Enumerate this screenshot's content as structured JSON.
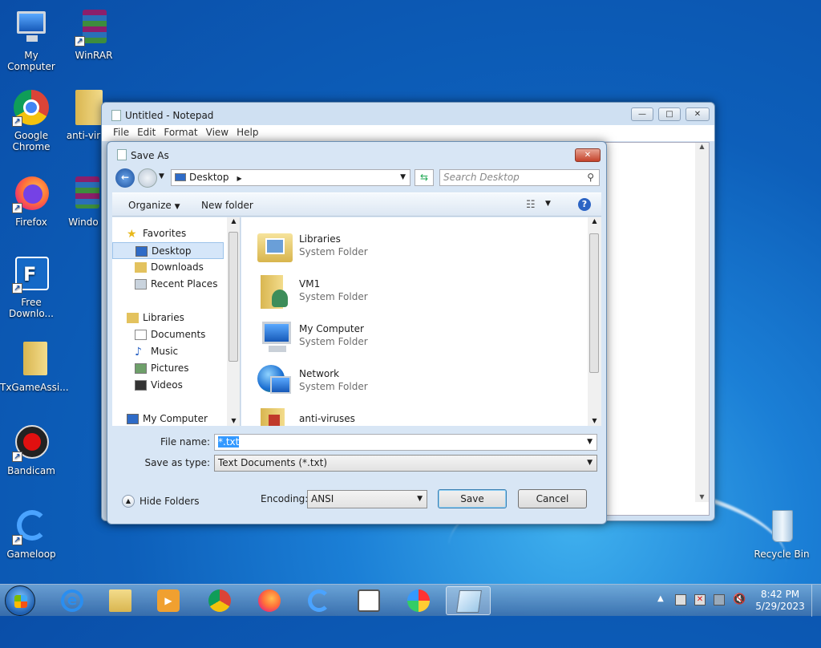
{
  "desktop": {
    "icons": [
      {
        "label": "My Computer"
      },
      {
        "label": "WinRAR"
      },
      {
        "label": "Google Chrome"
      },
      {
        "label": "anti-vir"
      },
      {
        "label": "Firefox"
      },
      {
        "label": "Windo"
      },
      {
        "label": "Free Downlo..."
      },
      {
        "label": "TxGameAssi..."
      },
      {
        "label": "Bandicam"
      },
      {
        "label": "Gameloop"
      },
      {
        "label": "Recycle Bin"
      }
    ]
  },
  "notepad": {
    "title": "Untitled - Notepad",
    "menu": [
      "File",
      "Edit",
      "Format",
      "View",
      "Help"
    ]
  },
  "dialog": {
    "title": "Save As",
    "address": "Desktop",
    "search_placeholder": "Search Desktop",
    "toolbar": {
      "organize": "Organize",
      "new_folder": "New folder"
    },
    "nav": {
      "favorites": "Favorites",
      "fav_items": [
        "Desktop",
        "Downloads",
        "Recent Places"
      ],
      "libraries": "Libraries",
      "lib_items": [
        "Documents",
        "Music",
        "Pictures",
        "Videos"
      ],
      "computer": "My Computer"
    },
    "files": [
      {
        "name": "Libraries",
        "type": "System Folder"
      },
      {
        "name": "VM1",
        "type": "System Folder"
      },
      {
        "name": "My Computer",
        "type": "System Folder"
      },
      {
        "name": "Network",
        "type": "System Folder"
      },
      {
        "name": "anti-viruses",
        "type": ""
      }
    ],
    "file_name_label": "File name:",
    "file_name_value": "*.txt",
    "save_type_label": "Save as type:",
    "save_type_value": "Text Documents (*.txt)",
    "hide_folders": "Hide Folders",
    "encoding_label": "Encoding:",
    "encoding_value": "ANSI",
    "save": "Save",
    "cancel": "Cancel"
  },
  "taskbar": {
    "time": "8:42 PM",
    "date": "5/29/2023"
  }
}
